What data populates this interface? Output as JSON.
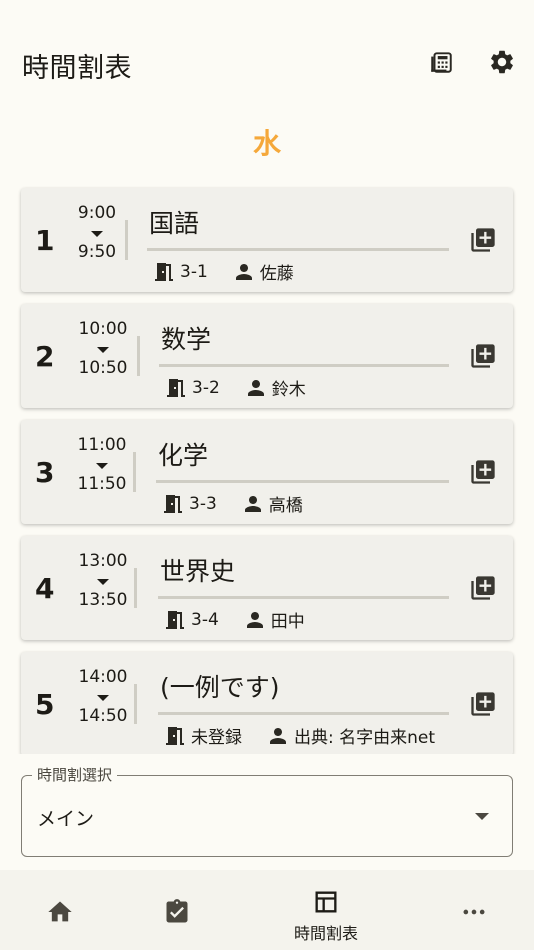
{
  "header": {
    "title": "時間割表",
    "calculator_icon": "calculator-icon",
    "settings_icon": "gear-icon"
  },
  "day": {
    "label": "水",
    "color": "#f5a83a"
  },
  "periods": [
    {
      "number": "1",
      "start": "9:00",
      "end": "9:50",
      "subject": "国語",
      "room": "3-1",
      "teacher": "佐藤"
    },
    {
      "number": "2",
      "start": "10:00",
      "end": "10:50",
      "subject": "数学",
      "room": "3-2",
      "teacher": "鈴木"
    },
    {
      "number": "3",
      "start": "11:00",
      "end": "11:50",
      "subject": "化学",
      "room": "3-3",
      "teacher": "高橋"
    },
    {
      "number": "4",
      "start": "13:00",
      "end": "13:50",
      "subject": "世界史",
      "room": "3-4",
      "teacher": "田中"
    },
    {
      "number": "5",
      "start": "14:00",
      "end": "14:50",
      "subject": "(一例です)",
      "room": "未登録",
      "teacher": "出典: 名字由来net"
    }
  ],
  "timetable_select": {
    "label": "時間割選択",
    "value": "メイン"
  },
  "bottom_nav": {
    "items": [
      {
        "icon": "home-icon",
        "label": ""
      },
      {
        "icon": "task-check-icon",
        "label": ""
      },
      {
        "icon": "table-icon",
        "label": "時間割表",
        "active": true
      },
      {
        "icon": "more-icon",
        "label": ""
      }
    ]
  }
}
